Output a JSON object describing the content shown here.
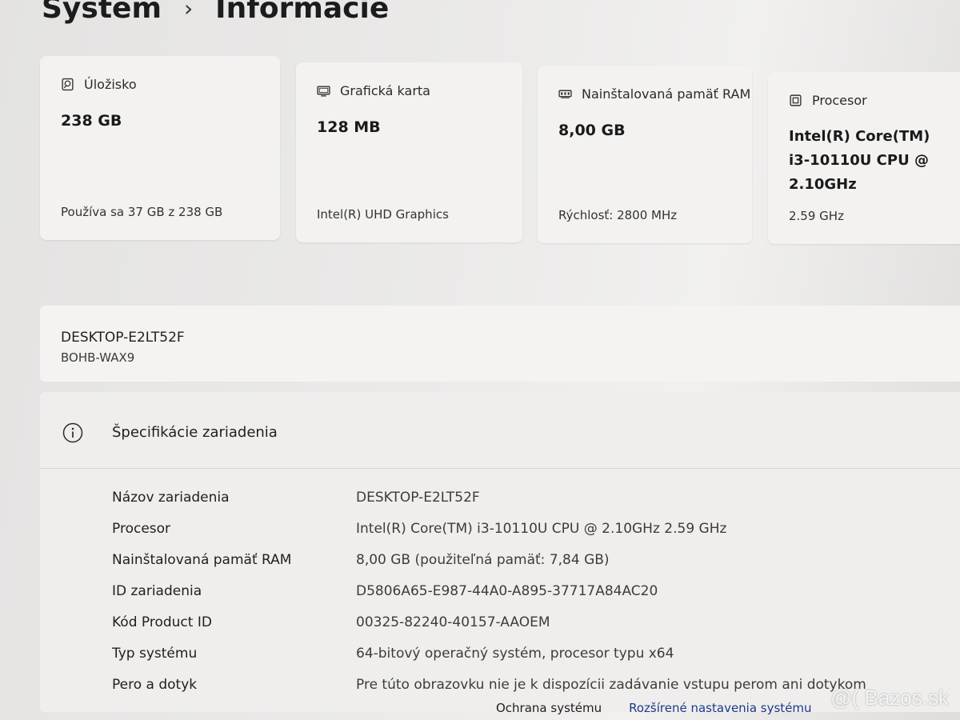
{
  "breadcrumb": {
    "parent": "System",
    "current": "Informácie"
  },
  "cards": {
    "storage": {
      "icon": "storage-icon",
      "title": "Úložisko",
      "value": "238 GB",
      "sub": "Používa sa 37 GB z 238 GB"
    },
    "gpu": {
      "icon": "display-icon",
      "title": "Grafická karta",
      "value": "128 MB",
      "sub": "Intel(R) UHD Graphics"
    },
    "ram": {
      "icon": "memory-icon",
      "title": "Nainštalovaná pamäť RAM",
      "value": "8,00 GB",
      "sub": "Rýchlosť: 2800 MHz"
    },
    "cpu": {
      "icon": "processor-icon",
      "title": "Procesor",
      "value": "Intel(R) Core(TM) i3-10110U CPU @ 2.10GHz",
      "sub": "2.59 GHz"
    }
  },
  "device": {
    "name": "DESKTOP-E2LT52F",
    "model": "BOHB-WAX9"
  },
  "specs": {
    "title": "Špecifikácie zariadenia",
    "rows": [
      {
        "label": "Názov zariadenia",
        "value": "DESKTOP-E2LT52F"
      },
      {
        "label": "Procesor",
        "value": "Intel(R) Core(TM) i3-10110U CPU @ 2.10GHz   2.59 GHz"
      },
      {
        "label": "Nainštalovaná pamäť RAM",
        "value": "8,00 GB (použiteľná pamäť: 7,84 GB)"
      },
      {
        "label": "ID zariadenia",
        "value": "D5806A65-E987-44A0-A895-37717A84AC20"
      },
      {
        "label": "Kód Product ID",
        "value": "00325-82240-40157-AAOEM"
      },
      {
        "label": "Typ systému",
        "value": "64-bitový operačný systém, procesor typu x64"
      },
      {
        "label": "Pero a dotyk",
        "value": "Pre túto obrazovku nie je k dispozícii zadávanie vstupu perom ani dotykom"
      }
    ]
  },
  "links": {
    "protection": "Ochrana systému",
    "advanced": "Rozšírené nastavenia systému"
  },
  "watermark": "@( Bazos.sk"
}
